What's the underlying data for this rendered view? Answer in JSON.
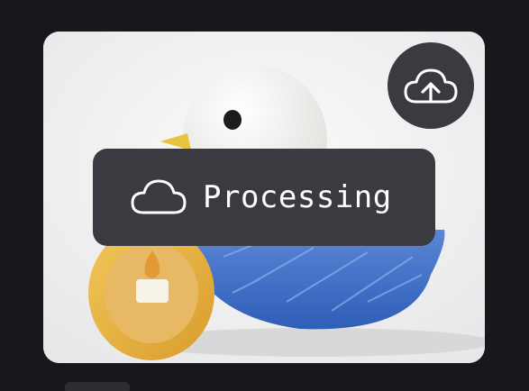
{
  "status": {
    "label": "Processing",
    "icon": "cloud-icon"
  },
  "actions": {
    "upload_icon": "cloud-upload-icon"
  },
  "colors": {
    "background": "#17181c",
    "overlay": "#3a3b40",
    "text": "#ffffff"
  }
}
